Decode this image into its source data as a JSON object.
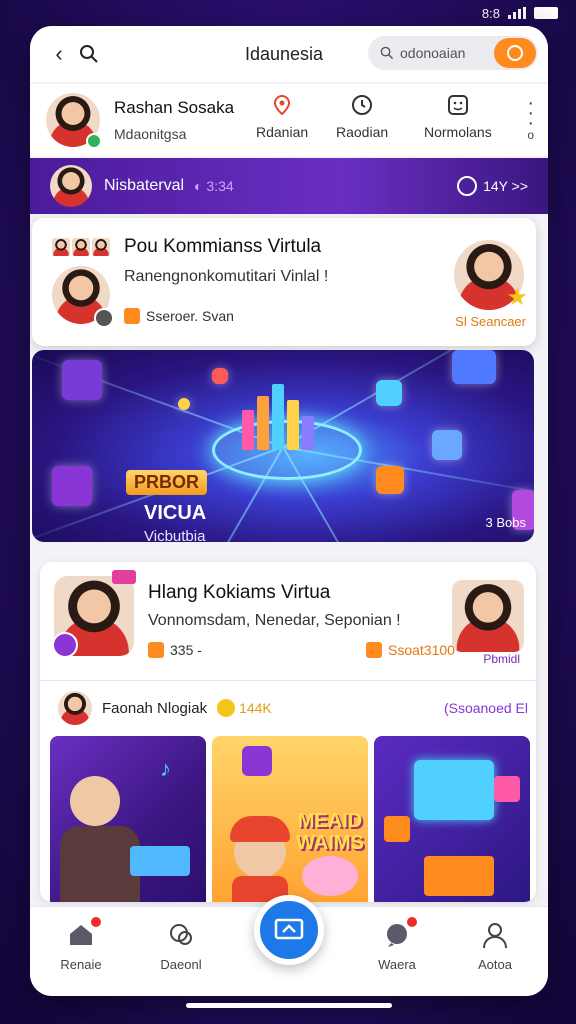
{
  "status": {
    "time": "8:8"
  },
  "topbar": {
    "title": "Idaunesia",
    "search_placeholder": "odonoaian"
  },
  "profile": {
    "name": "Rashan Sosaka",
    "handle": "Mdaonitgsa",
    "actions": [
      {
        "label": "Rdanian",
        "icon": "location-pin-icon"
      },
      {
        "label": "Raodian",
        "icon": "clock-icon"
      },
      {
        "label": "Normolans",
        "icon": "emoji-icon"
      }
    ],
    "more_label": "o"
  },
  "stream_bar": {
    "name": "Nisbaterval",
    "time": "3:34",
    "right": "14Y >>"
  },
  "card1": {
    "title": "Pou Kommianss Virtula",
    "subtitle": "Ranengnonkomutitari Vinlal !",
    "tag": "Sseroer. Svan",
    "right_tag": "Sl Seancaer"
  },
  "banner": {
    "badge": "PRBOR",
    "title": "VICUA",
    "subtitle": "Vicbutbia",
    "count": "3 Bobs"
  },
  "card2": {
    "title": "Hlang Kokiams Virtua",
    "subtitle": "Vonnomsdam, Nenedar, Seponian !",
    "meta": "335 -",
    "price": "Ssoat3100",
    "right_label": "Pbmidl",
    "host_name": "Faonah Nlogiak",
    "host_coins": "144K",
    "host_right": "(Ssoanoed El",
    "tile_title": "MEAID WAIMS"
  },
  "nav": [
    {
      "label": "Renaie",
      "icon": "home-icon",
      "dot": true
    },
    {
      "label": "Daeonl",
      "icon": "chat-icon",
      "dot": false
    },
    {
      "label": "Waera",
      "icon": "message-icon",
      "dot": true
    },
    {
      "label": "Aotoa",
      "icon": "profile-icon",
      "dot": false
    }
  ],
  "colors": {
    "accent": "#ff8a1e",
    "brand": "#6a2fc2",
    "primary_button": "#1d78e8"
  }
}
